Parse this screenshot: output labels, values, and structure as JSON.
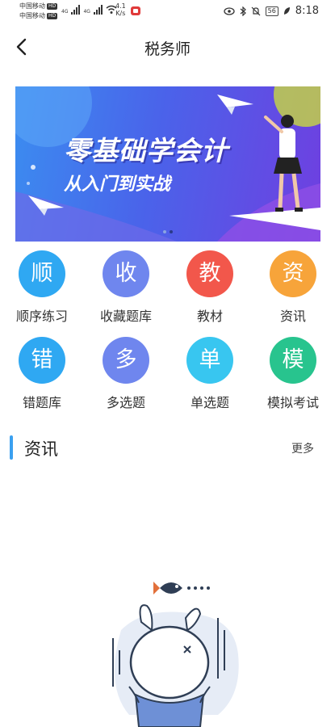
{
  "status_bar": {
    "carrier_1": "中国移动",
    "carrier_2": "中国移动",
    "hd_badge": "HD",
    "network_type": "4G",
    "speed_value": "4.1",
    "speed_unit": "K/s",
    "battery": "56",
    "time": "8:18"
  },
  "header": {
    "title": "税务师",
    "back_icon": "chevron-left-icon"
  },
  "banner": {
    "title": "零基础学会计",
    "subtitle": "从入门到实战",
    "slide_count": 2,
    "active_slide": 2
  },
  "menu": [
    {
      "char": "顺",
      "label": "顺序练习",
      "color": "#2fa8f2"
    },
    {
      "char": "收",
      "label": "收藏题库",
      "color": "#6f86ee"
    },
    {
      "char": "教",
      "label": "教材",
      "color": "#f2574b"
    },
    {
      "char": "资",
      "label": "资讯",
      "color": "#f7a43a"
    },
    {
      "char": "错",
      "label": "错题库",
      "color": "#2fa8f2"
    },
    {
      "char": "多",
      "label": "多选题",
      "color": "#6f86ee"
    },
    {
      "char": "单",
      "label": "单选题",
      "color": "#38c6f0"
    },
    {
      "char": "模",
      "label": "模拟考试",
      "color": "#28c48e"
    }
  ],
  "news_section": {
    "title": "资讯",
    "more": "更多"
  },
  "colors": {
    "accent": "#3aa0f0",
    "banner_start": "#3b8df0",
    "banner_end": "#6f3fe0"
  }
}
